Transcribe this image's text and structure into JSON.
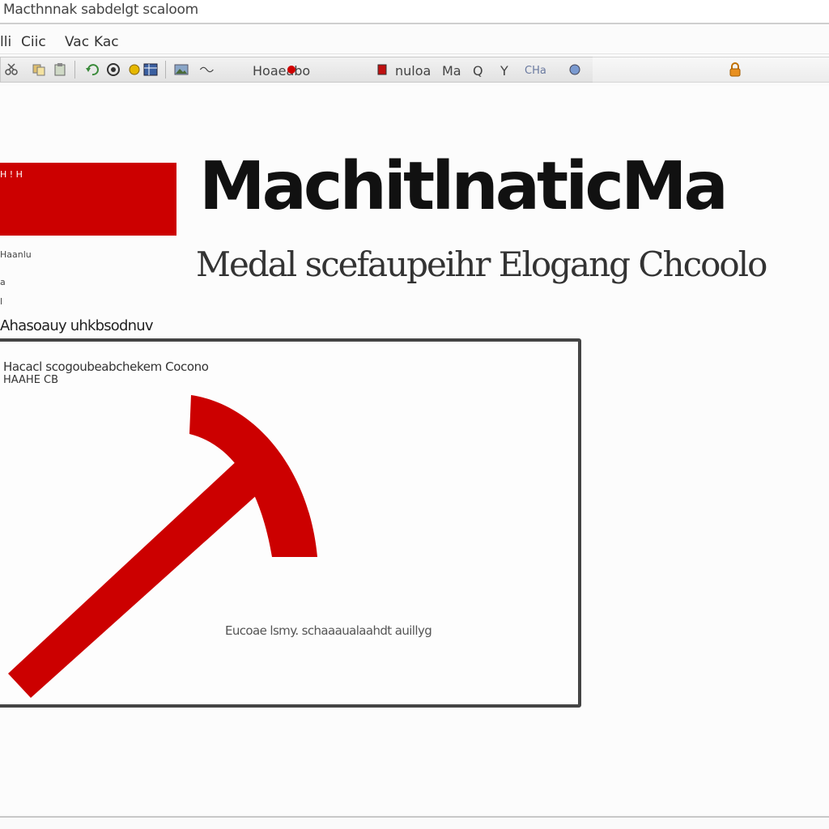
{
  "window": {
    "title": "Macthnnak sabdelgt scaloom"
  },
  "menubar": {
    "items": [
      {
        "label": "lli"
      },
      {
        "label": "Ciic"
      },
      {
        "label": "Vac"
      },
      {
        "label": "Kac"
      }
    ]
  },
  "toolbar": {
    "labels": [
      {
        "label": "Hoaeabo"
      },
      {
        "label": "nuloa"
      },
      {
        "label": "Ma"
      },
      {
        "label": "Q"
      },
      {
        "label": "Y"
      },
      {
        "label": "CHa"
      }
    ],
    "icons": [
      "cut-icon",
      "copy-icon",
      "paste-icon",
      "undo-icon",
      "redo-icon",
      "refresh-icon",
      "grid-icon",
      "image-icon",
      "link-icon",
      "record-icon",
      "lock-icon"
    ]
  },
  "sidebar": {
    "banner_text": "H ! H",
    "small_lines": [
      {
        "label": "Haanlu"
      },
      {
        "label": "a"
      },
      {
        "label": "l"
      }
    ],
    "heading": "Ahasoauy uhkbsodnuv"
  },
  "header": {
    "title": "MachitlnaticMa",
    "subtitle": "Medal scefaupeihr Elogang Chcoolo"
  },
  "panel": {
    "caption": "Hacacl scogoubeabchekem Cocono",
    "sub": "HAAHE CB",
    "footer": "Eucoae lsmy. schaaaualaahdt auillyg",
    "logo_color": "#cc0000"
  },
  "colors": {
    "accent": "#cc0000",
    "toolbar_bg": "#e8e8e8"
  }
}
